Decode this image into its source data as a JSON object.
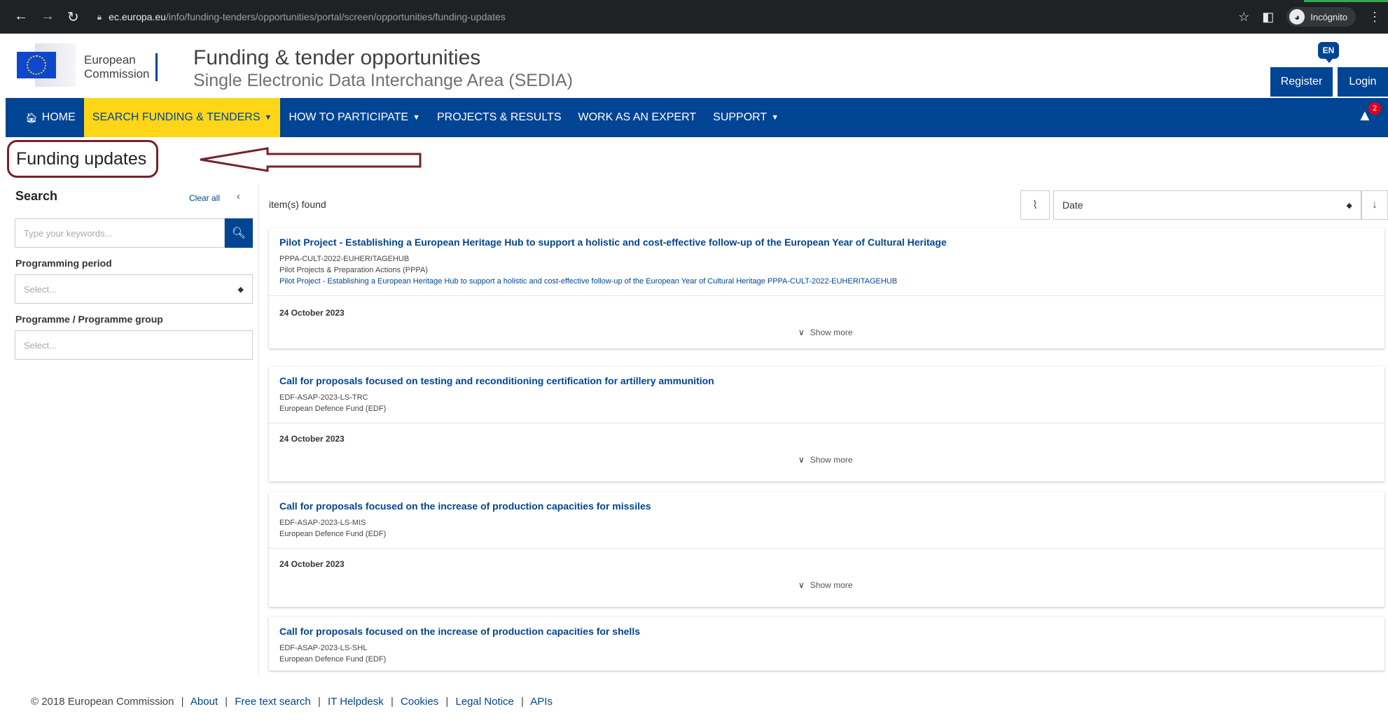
{
  "browser": {
    "url_host": "ec.europa.eu",
    "url_path": "/info/funding-tenders/opportunities/portal/screen/opportunities/funding-updates",
    "profile_label": "Incógnito"
  },
  "header": {
    "org_line1": "European",
    "org_line2": "Commission",
    "title": "Funding & tender opportunities",
    "subtitle": "Single Electronic Data Interchange Area (SEDIA)",
    "lang": "EN",
    "register_label": "Register",
    "login_label": "Login"
  },
  "nav": {
    "home": "HOME",
    "search": "SEARCH FUNDING & TENDERS",
    "participate": "HOW TO PARTICIPATE",
    "projects": "PROJECTS & RESULTS",
    "expert": "WORK AS AN EXPERT",
    "support": "SUPPORT",
    "alert_count": "2"
  },
  "page": {
    "title": "Funding updates"
  },
  "sidebar": {
    "heading": "Search",
    "clear_all": "Clear all",
    "search_placeholder": "Type your keywords...",
    "period_label": "Programming period",
    "period_placeholder": "Select...",
    "programme_label": "Programme / Programme group",
    "programme_placeholder": "Select..."
  },
  "results": {
    "items_found": "item(s) found",
    "sort_value": "Date",
    "show_more": "Show more",
    "cards": [
      {
        "title": "Pilot Project - Establishing a European Heritage Hub to support a holistic and cost-effective follow-up of the European Year of Cultural Heritage",
        "code": "PPPA-CULT-2022-EUHERITAGEHUB",
        "programme": "Pilot Projects & Preparation Actions (PPPA)",
        "description": "Pilot Project - Establishing a European Heritage Hub to support a holistic and cost-effective follow-up of the European Year of Cultural Heritage PPPA-CULT-2022-EUHERITAGEHUB",
        "date": "24 October 2023"
      },
      {
        "title": "Call for proposals focused on testing and reconditioning certification for artillery ammunition",
        "code": "EDF-ASAP-2023-LS-TRC",
        "programme": "European Defence Fund (EDF)",
        "date": "24 October 2023"
      },
      {
        "title": "Call for proposals focused on the increase of production capacities for missiles",
        "code": "EDF-ASAP-2023-LS-MIS",
        "programme": "European Defence Fund (EDF)",
        "date": "24 October 2023"
      },
      {
        "title": "Call for proposals focused on the increase of production capacities for shells",
        "code": "EDF-ASAP-2023-LS-SHL",
        "programme": "European Defence Fund (EDF)"
      }
    ]
  },
  "footer": {
    "copyright": "© 2018 European Commission",
    "links": [
      "About",
      "Free text search",
      "IT Helpdesk",
      "Cookies",
      "Legal Notice",
      "APIs"
    ]
  },
  "colors": {
    "brand_blue": "#004494",
    "active_yellow": "#ffd617",
    "annotation_red": "#7a1f2b"
  }
}
